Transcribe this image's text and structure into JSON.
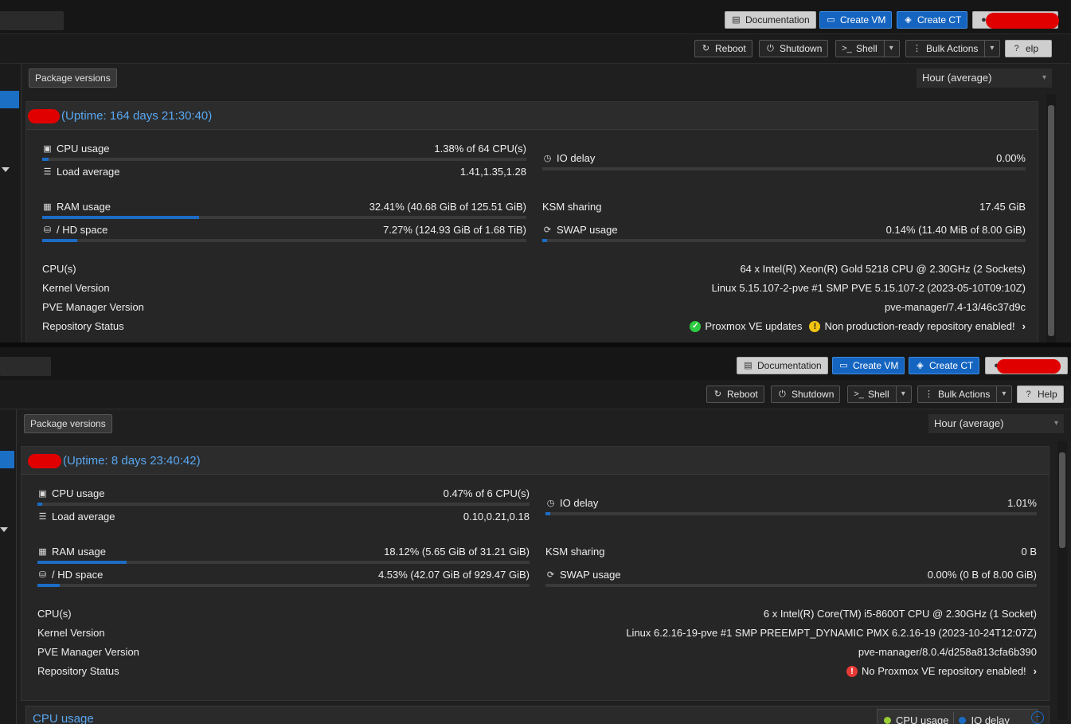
{
  "top": {
    "documentation": "Documentation",
    "create_vm": "Create VM",
    "create_ct": "Create CT",
    "reboot": "Reboot",
    "shutdown": "Shutdown",
    "shell": "Shell",
    "bulk_actions": "Bulk Actions",
    "help_partial": "elp",
    "help": "Help",
    "package_versions": "Package versions",
    "timeframe": "Hour (average)"
  },
  "node1": {
    "uptime": "(Uptime: 164 days 21:30:40)",
    "cpu_label": "CPU usage",
    "cpu_value": "1.38% of 64 CPU(s)",
    "cpu_pct": 1.38,
    "load_label": "Load average",
    "load_value": "1.41,1.35,1.28",
    "ram_label": "RAM usage",
    "ram_value": "32.41% (40.68 GiB of 125.51 GiB)",
    "ram_pct": 32.41,
    "hd_label": "/ HD space",
    "hd_value": "7.27% (124.93 GiB of 1.68 TiB)",
    "hd_pct": 7.27,
    "io_label": "IO delay",
    "io_value": "0.00%",
    "io_pct": 0.0,
    "ksm_label": "KSM sharing",
    "ksm_value": "17.45 GiB",
    "swap_label": "SWAP usage",
    "swap_value": "0.14% (11.40 MiB of 8.00 GiB)",
    "swap_pct": 0.14,
    "cpus_label": "CPU(s)",
    "cpus_value": "64 x Intel(R) Xeon(R) Gold 5218 CPU @ 2.30GHz (2 Sockets)",
    "kernel_label": "Kernel Version",
    "kernel_value": "Linux 5.15.107-2-pve #1 SMP PVE 5.15.107-2 (2023-05-10T09:10Z)",
    "pve_label": "PVE Manager Version",
    "pve_value": "pve-manager/7.4-13/46c37d9c",
    "repo_label": "Repository Status",
    "repo_ok": "Proxmox VE updates",
    "repo_warn": "Non production-ready repository enabled!"
  },
  "node2": {
    "uptime": "(Uptime: 8 days 23:40:42)",
    "cpu_label": "CPU usage",
    "cpu_value": "0.47% of 6 CPU(s)",
    "cpu_pct": 0.47,
    "load_label": "Load average",
    "load_value": "0.10,0.21,0.18",
    "ram_label": "RAM usage",
    "ram_value": "18.12% (5.65 GiB of 31.21 GiB)",
    "ram_pct": 18.12,
    "hd_label": "/ HD space",
    "hd_value": "4.53% (42.07 GiB of 929.47 GiB)",
    "hd_pct": 4.53,
    "io_label": "IO delay",
    "io_value": "1.01%",
    "io_pct": 1.01,
    "ksm_label": "KSM sharing",
    "ksm_value": "0 B",
    "swap_label": "SWAP usage",
    "swap_value": "0.00% (0 B of 8.00 GiB)",
    "swap_pct": 0.0,
    "cpus_label": "CPU(s)",
    "cpus_value": "6 x Intel(R) Core(TM) i5-8600T CPU @ 2.30GHz (1 Socket)",
    "kernel_label": "Kernel Version",
    "kernel_value": "Linux 6.2.16-19-pve #1 SMP PREEMPT_DYNAMIC PMX 6.2.16-19 (2023-10-24T12:07Z)",
    "pve_label": "PVE Manager Version",
    "pve_value": "pve-manager/8.0.4/d258a813cfa6b390",
    "repo_label": "Repository Status",
    "repo_err": "No Proxmox VE repository enabled!"
  },
  "bottom": {
    "title": "CPU usage",
    "legend_cpu": "CPU usage",
    "legend_io": "IO delay"
  },
  "colors": {
    "accent": "#1c6cc5",
    "link": "#59a7f1",
    "redaction": "#e00000"
  }
}
